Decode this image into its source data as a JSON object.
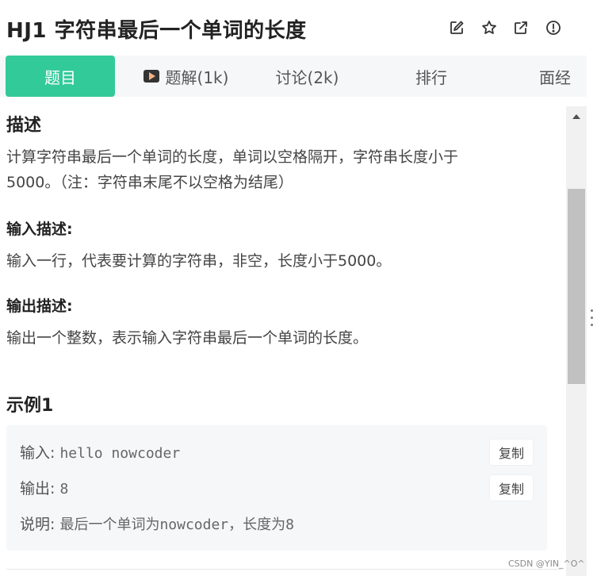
{
  "header": {
    "title": "HJ1  字符串最后一个单词的长度",
    "icons": [
      "edit-icon",
      "star-icon",
      "external-link-icon",
      "info-icon"
    ]
  },
  "tabs": [
    {
      "label": "题目",
      "active": true
    },
    {
      "label": "题解(1k)",
      "icon": "video-icon"
    },
    {
      "label": "讨论(2k)"
    },
    {
      "label": "排行"
    },
    {
      "label": "面经"
    }
  ],
  "problem": {
    "description_heading": "描述",
    "description_line1": "计算字符串最后一个单词的长度，单词以空格隔开，字符串长度小于",
    "description_line2": "5000。（注：字符串末尾不以空格为结尾）",
    "input_heading": "输入描述:",
    "input_text": "输入一行，代表要计算的字符串，非空，长度小于5000。",
    "output_heading": "输出描述:",
    "output_text": "输出一个整数，表示输入字符串最后一个单词的长度。",
    "example_heading": "示例1"
  },
  "example": {
    "input_label": "输入:",
    "input_value": "hello nowcoder",
    "output_label": "输出:",
    "output_value": "8",
    "explain_label": "说明:",
    "explain_value": "最后一个单词为nowcoder，长度为8",
    "copy_label": "复制"
  },
  "watermark": "CSDN @YIN_^O^",
  "colors": {
    "accent": "#32ca99",
    "tab_bar_bg": "#f6f7f9",
    "example_bg": "#f6f7f9"
  }
}
